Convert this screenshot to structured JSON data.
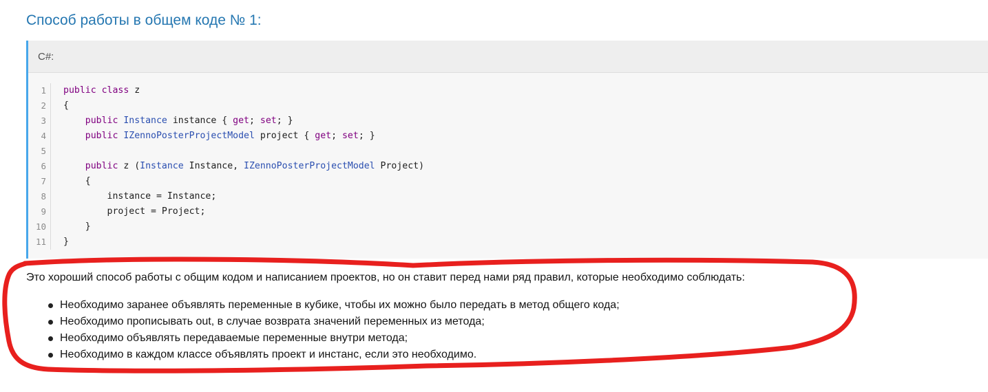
{
  "heading": "Способ работы в общем коде № 1:",
  "code_block": {
    "language_label": "C#:",
    "lines": [
      {
        "number": "1",
        "tokens": [
          {
            "t": "kw",
            "v": "public class"
          },
          {
            "t": "plain",
            "v": " z"
          }
        ]
      },
      {
        "number": "2",
        "tokens": [
          {
            "t": "plain",
            "v": "{"
          }
        ]
      },
      {
        "number": "3",
        "tokens": [
          {
            "t": "plain",
            "v": "    "
          },
          {
            "t": "kw",
            "v": "public"
          },
          {
            "t": "plain",
            "v": " "
          },
          {
            "t": "type",
            "v": "Instance"
          },
          {
            "t": "plain",
            "v": " instance { "
          },
          {
            "t": "kw",
            "v": "get"
          },
          {
            "t": "plain",
            "v": "; "
          },
          {
            "t": "kw",
            "v": "set"
          },
          {
            "t": "plain",
            "v": "; }"
          }
        ]
      },
      {
        "number": "4",
        "tokens": [
          {
            "t": "plain",
            "v": "    "
          },
          {
            "t": "kw",
            "v": "public"
          },
          {
            "t": "plain",
            "v": " "
          },
          {
            "t": "type",
            "v": "IZennoPosterProjectModel"
          },
          {
            "t": "plain",
            "v": " project { "
          },
          {
            "t": "kw",
            "v": "get"
          },
          {
            "t": "plain",
            "v": "; "
          },
          {
            "t": "kw",
            "v": "set"
          },
          {
            "t": "plain",
            "v": "; }"
          }
        ]
      },
      {
        "number": "5",
        "tokens": [
          {
            "t": "plain",
            "v": ""
          }
        ]
      },
      {
        "number": "6",
        "tokens": [
          {
            "t": "plain",
            "v": "    "
          },
          {
            "t": "kw",
            "v": "public"
          },
          {
            "t": "plain",
            "v": " z ("
          },
          {
            "t": "type",
            "v": "Instance"
          },
          {
            "t": "plain",
            "v": " Instance, "
          },
          {
            "t": "type",
            "v": "IZennoPosterProjectModel"
          },
          {
            "t": "plain",
            "v": " Project)"
          }
        ]
      },
      {
        "number": "7",
        "tokens": [
          {
            "t": "plain",
            "v": "    {"
          }
        ]
      },
      {
        "number": "8",
        "tokens": [
          {
            "t": "plain",
            "v": "        instance = Instance;"
          }
        ]
      },
      {
        "number": "9",
        "tokens": [
          {
            "t": "plain",
            "v": "        project = Project;"
          }
        ]
      },
      {
        "number": "10",
        "tokens": [
          {
            "t": "plain",
            "v": "    }"
          }
        ]
      },
      {
        "number": "11",
        "tokens": [
          {
            "t": "plain",
            "v": "}"
          }
        ]
      }
    ]
  },
  "intro_text": "Это хороший способ работы с общим кодом и написанием проектов, но он ставит перед нами ряд правил, которые необходимо соблюдать:",
  "bullets": [
    "Необходимо заранее объявлять переменные в кубике, чтобы их можно было передать в метод общего кода;",
    "Необходимо прописывать out, в случае возврата значений переменных из метода;",
    "Необходимо объявлять передаваемые переменные внутри метода;",
    "Необходимо в каждом классе объявлять проект и инстанс, если это необходимо."
  ],
  "annotation_color": "#e8201e"
}
